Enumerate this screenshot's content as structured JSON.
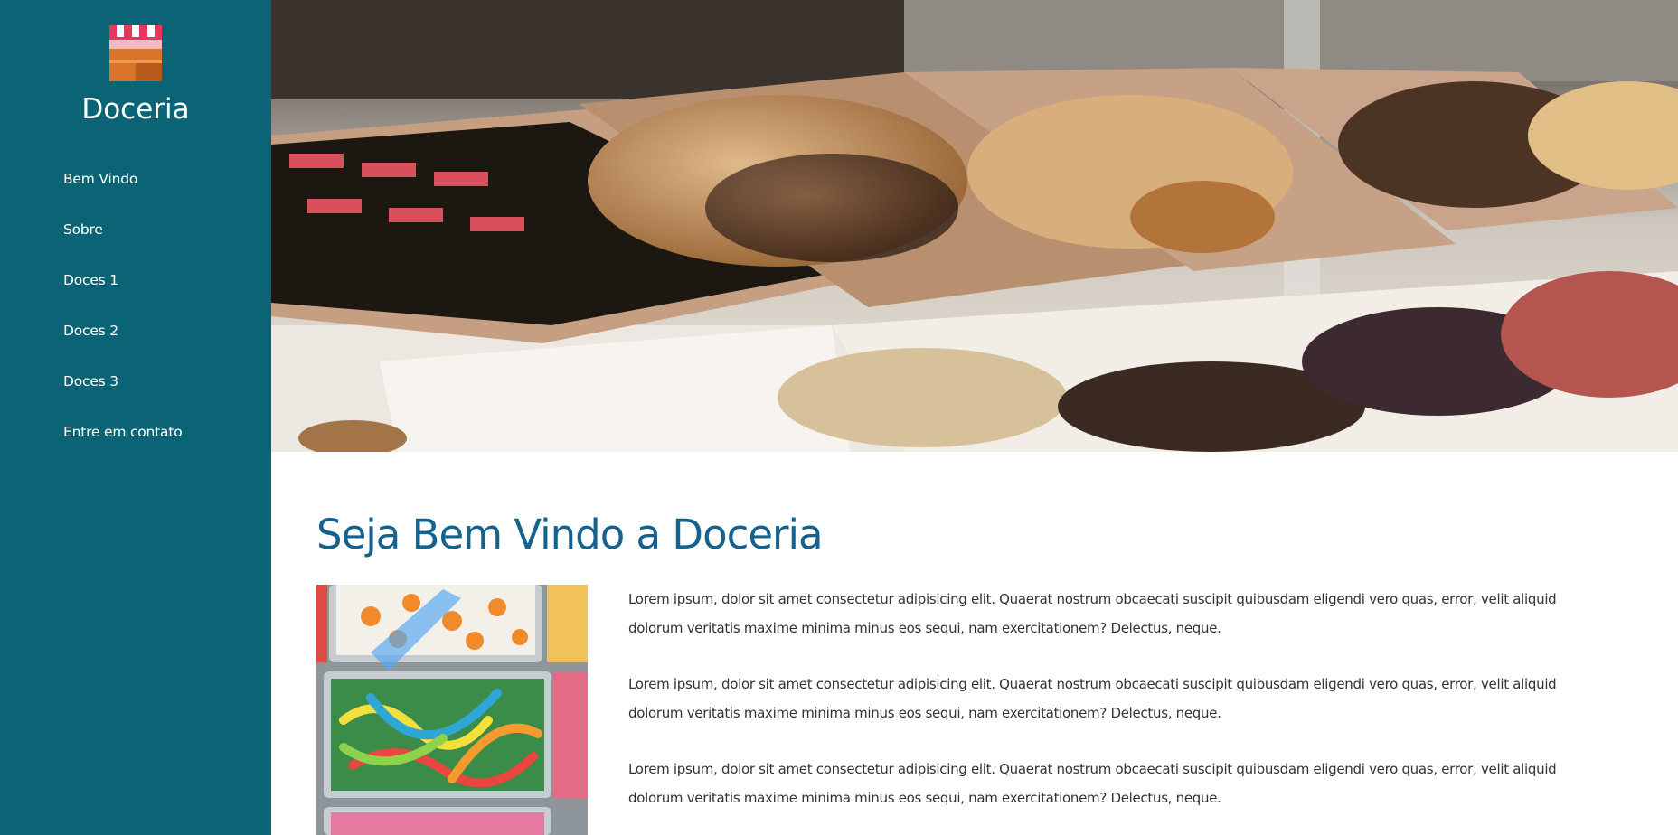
{
  "brand": {
    "name": "Doceria",
    "logo_icon": "shop-stall-icon"
  },
  "nav": {
    "items": [
      {
        "label": "Bem Vindo"
      },
      {
        "label": "Sobre"
      },
      {
        "label": "Doces 1"
      },
      {
        "label": "Doces 2"
      },
      {
        "label": "Doces 3"
      },
      {
        "label": "Entre em contato"
      }
    ]
  },
  "main": {
    "title": "Seja Bem Vindo a Doceria",
    "paragraphs": [
      "Lorem ipsum, dolor sit amet consectetur adipisicing elit. Quaerat nostrum obcaecati suscipit quibusdam eligendi vero quas, error, velit aliquid dolorum veritatis maxime minima minus eos sequi, nam exercitationem? Delectus, neque.",
      "Lorem ipsum, dolor sit amet consectetur adipisicing elit. Quaerat nostrum obcaecati suscipit quibusdam eligendi vero quas, error, velit aliquid dolorum veritatis maxime minima minus eos sequi, nam exercitationem? Delectus, neque.",
      "Lorem ipsum, dolor sit amet consectetur adipisicing elit. Quaerat nostrum obcaecati suscipit quibusdam eligendi vero quas, error, velit aliquid dolorum veritatis maxime minima minus eos sequi, nam exercitationem? Delectus, neque."
    ]
  },
  "colors": {
    "sidebar": "#0b6475",
    "title": "#15628f",
    "text": "#333333"
  }
}
